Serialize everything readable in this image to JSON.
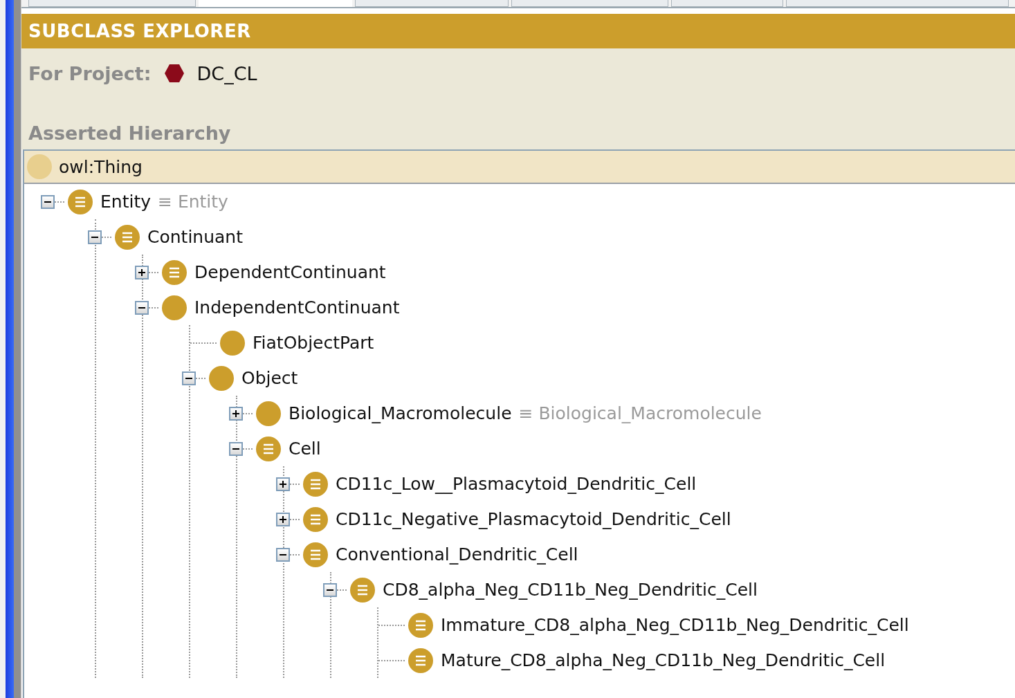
{
  "tabs": [
    {
      "selected": false
    },
    {
      "selected": true
    },
    {
      "selected": false
    },
    {
      "selected": false
    },
    {
      "selected": false
    },
    {
      "selected": false
    }
  ],
  "panel": {
    "title": "SUBCLASS EXPLORER",
    "project_label": "For Project:",
    "project_name": "DC_CL",
    "hierarchy_label": "Asserted Hierarchy"
  },
  "tree": {
    "root": {
      "label": "owl:Thing",
      "selected": true
    },
    "nodes": [
      {
        "label": "Entity",
        "equivalent": "≡ Entity",
        "kind": "defined",
        "expanded": true,
        "selected": false,
        "children": [
          {
            "label": "Continuant",
            "kind": "defined",
            "expanded": true,
            "selected": false,
            "children": [
              {
                "label": "DependentContinuant",
                "kind": "defined",
                "expanded": false,
                "selected": false
              },
              {
                "label": "IndependentContinuant",
                "kind": "primitive",
                "expanded": true,
                "selected": false,
                "children": [
                  {
                    "label": "FiatObjectPart",
                    "kind": "primitive",
                    "selected": false
                  },
                  {
                    "label": "Object",
                    "kind": "primitive",
                    "expanded": true,
                    "selected": false,
                    "children": [
                      {
                        "label": "Biological_Macromolecule",
                        "equivalent": "≡ Biological_Macromolecule",
                        "kind": "primitive",
                        "expanded": false,
                        "selected": false
                      },
                      {
                        "label": "Cell",
                        "kind": "defined",
                        "expanded": true,
                        "selected": false,
                        "children": [
                          {
                            "label": "CD11c_Low__Plasmacytoid_Dendritic_Cell",
                            "kind": "defined",
                            "expanded": false,
                            "selected": false
                          },
                          {
                            "label": "CD11c_Negative_Plasmacytoid_Dendritic_Cell",
                            "kind": "defined",
                            "expanded": false,
                            "selected": false
                          },
                          {
                            "label": "Conventional_Dendritic_Cell",
                            "kind": "defined",
                            "expanded": true,
                            "selected": false,
                            "children": [
                              {
                                "label": "CD8_alpha_Neg_CD11b_Neg_Dendritic_Cell",
                                "kind": "defined",
                                "expanded": true,
                                "selected": false,
                                "children": [
                                  {
                                    "label": "Immature_CD8_alpha_Neg_CD11b_Neg_Dendritic_Cell",
                                    "kind": "defined",
                                    "selected": false
                                  },
                                  {
                                    "label": "Mature_CD8_alpha_Neg_CD11b_Neg_Dendritic_Cell",
                                    "kind": "defined",
                                    "selected": false
                                  }
                                ]
                              }
                            ]
                          }
                        ]
                      }
                    ]
                  }
                ]
              }
            ]
          }
        ]
      }
    ]
  }
}
